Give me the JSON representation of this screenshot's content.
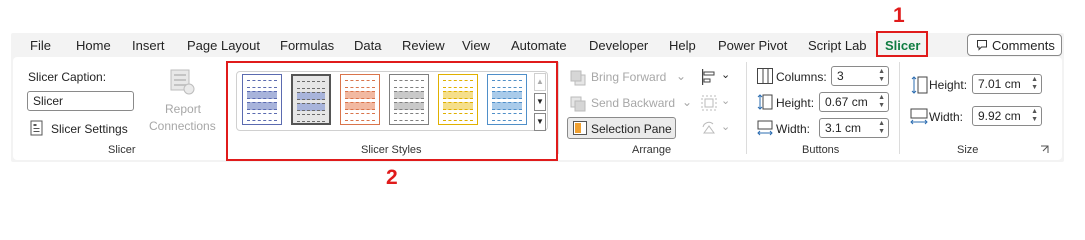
{
  "tabs": [
    "File",
    "Home",
    "Insert",
    "Page Layout",
    "Formulas",
    "Data",
    "Review",
    "View",
    "Automate",
    "Developer",
    "Help",
    "Power Pivot",
    "Script Lab",
    "Slicer"
  ],
  "active_tab": "Slicer",
  "comments_label": "Comments",
  "slicer_group": {
    "caption_label": "Slicer Caption:",
    "caption_value": "Slicer",
    "settings_label": "Slicer Settings",
    "report_connections_line1": "Report",
    "report_connections_line2": "Connections",
    "group_label": "Slicer"
  },
  "styles_group": {
    "group_label": "Slicer Styles",
    "styles": [
      {
        "name": "style-light-1",
        "color": "#5b6bb0",
        "selected": false,
        "top": "#a8b4db"
      },
      {
        "name": "style-light-2",
        "color": "#6b6b6b",
        "selected": true,
        "top": "#a8b4db"
      },
      {
        "name": "style-light-3",
        "color": "#d9744b",
        "selected": false,
        "top": "#f2b9a1"
      },
      {
        "name": "style-light-4",
        "color": "#7f7f7f",
        "selected": false,
        "top": "#c9c9c9"
      },
      {
        "name": "style-light-5",
        "color": "#e0b000",
        "selected": false,
        "top": "#f5df8a"
      },
      {
        "name": "style-light-6",
        "color": "#4f8fc9",
        "selected": false,
        "top": "#a9cbea"
      }
    ]
  },
  "arrange_group": {
    "bring_forward": "Bring Forward",
    "send_backward": "Send Backward",
    "selection_pane": "Selection Pane",
    "group_label": "Arrange"
  },
  "buttons_group": {
    "columns_label": "Columns:",
    "columns_value": "3",
    "height_label": "Height:",
    "height_value": "0.67 cm",
    "width_label": "Width:",
    "width_value": "3.1 cm",
    "group_label": "Buttons"
  },
  "size_group": {
    "height_label": "Height:",
    "height_value": "7.01 cm",
    "width_label": "Width:",
    "width_value": "9.92 cm",
    "group_label": "Size"
  },
  "annotations": {
    "tab_marker": "1",
    "styles_marker": "2",
    "color": "#e01b1b"
  },
  "colors": {
    "accent_green": "#107c41",
    "ribbon_bg": "#f3f3f3"
  }
}
